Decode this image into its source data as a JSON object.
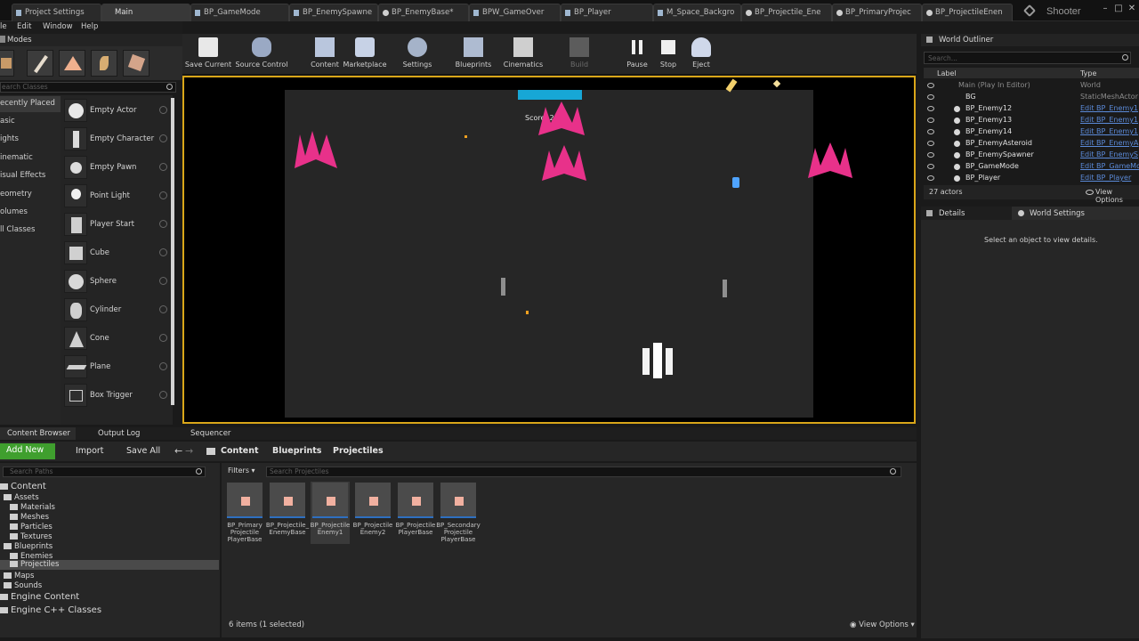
{
  "tabs": [
    {
      "label": "Project Settings",
      "icon": "gear-icon"
    },
    {
      "label": "Main",
      "icon": "level-icon"
    },
    {
      "label": "BP_GameMode",
      "icon": "blueprint-icon"
    },
    {
      "label": "BP_EnemySpawne",
      "icon": "blueprint-icon"
    },
    {
      "label": "BP_EnemyBase*",
      "icon": "blueprint-icon"
    },
    {
      "label": "BPW_GameOver",
      "icon": "widget-icon"
    },
    {
      "label": "BP_Player",
      "icon": "blueprint-icon"
    },
    {
      "label": "M_Space_Backgro",
      "icon": "material-icon"
    },
    {
      "label": "BP_Projectile_Ene",
      "icon": "blueprint-icon"
    },
    {
      "label": "BP_PrimaryProjec",
      "icon": "blueprint-icon"
    },
    {
      "label": "BP_ProjectileEnen",
      "icon": "blueprint-icon"
    }
  ],
  "project_name": "Shooter",
  "menu": [
    "le",
    "Edit",
    "Window",
    "Help"
  ],
  "modes": {
    "title": "Modes",
    "search_placeholder": "earch Classes",
    "categories": [
      "ecently Placed",
      "asic",
      "ights",
      "inematic",
      "isual Effects",
      "eometry",
      "olumes",
      "ll Classes"
    ],
    "items": [
      "Empty Actor",
      "Empty Character",
      "Empty Pawn",
      "Point Light",
      "Player Start",
      "Cube",
      "Sphere",
      "Cylinder",
      "Cone",
      "Plane",
      "Box Trigger"
    ]
  },
  "toolbar": [
    {
      "label": "Save Current",
      "icon": "save-icon"
    },
    {
      "label": "Source Control",
      "icon": "source-control-icon"
    },
    {
      "label": "Content",
      "icon": "content-icon"
    },
    {
      "label": "Marketplace",
      "icon": "marketplace-icon"
    },
    {
      "label": "Settings",
      "icon": "settings-icon"
    },
    {
      "label": "Blueprints",
      "icon": "blueprints-icon"
    },
    {
      "label": "Cinematics",
      "icon": "cinematics-icon"
    },
    {
      "label": "Build",
      "icon": "build-icon"
    },
    {
      "label": "Pause",
      "icon": "pause-icon"
    },
    {
      "label": "Stop",
      "icon": "stop-icon"
    },
    {
      "label": "Eject",
      "icon": "eject-icon"
    }
  ],
  "game": {
    "score_text": "Score: 25",
    "health_color": "#17a7d6",
    "enemy_color": "#e8318a"
  },
  "world_outliner": {
    "title": "World Outliner",
    "search_placeholder": "Search...",
    "col_label": "Label",
    "col_type": "Type",
    "rows": [
      {
        "label": "Main (Play In Editor)",
        "type": "World",
        "link": false
      },
      {
        "label": "BG",
        "type": "StaticMeshActor",
        "link": false
      },
      {
        "label": "BP_Enemy12",
        "type": "Edit BP_Enemy1",
        "link": true
      },
      {
        "label": "BP_Enemy13",
        "type": "Edit BP_Enemy1",
        "link": true
      },
      {
        "label": "BP_Enemy14",
        "type": "Edit BP_Enemy1",
        "link": true
      },
      {
        "label": "BP_EnemyAsteroid",
        "type": "Edit BP_EnemyA",
        "link": true
      },
      {
        "label": "BP_EnemySpawner",
        "type": "Edit BP_EnemyS",
        "link": true
      },
      {
        "label": "BP_GameMode",
        "type": "Edit BP_GameMo",
        "link": true
      },
      {
        "label": "BP_Player",
        "type": "Edit BP_Player",
        "link": true
      }
    ],
    "actor_count": "27 actors",
    "view_options": "View Options"
  },
  "details": {
    "tab_details": "Details",
    "tab_world_settings": "World Settings",
    "empty_text": "Select an object to view details."
  },
  "bottom_tabs": [
    "Content Browser",
    "Output Log",
    "Sequencer"
  ],
  "content_browser": {
    "add_new": "Add New",
    "import": "Import",
    "save_all": "Save All",
    "breadcrumbs": [
      "Content",
      "Blueprints",
      "Projectiles"
    ],
    "search_paths": "Search Paths",
    "filters": "Filters",
    "search_projectiles": "Search Projectiles",
    "tree": [
      {
        "label": "Content",
        "indent": 0,
        "big": true
      },
      {
        "label": "Assets",
        "indent": 1
      },
      {
        "label": "Materials",
        "indent": 2
      },
      {
        "label": "Meshes",
        "indent": 2
      },
      {
        "label": "Particles",
        "indent": 2
      },
      {
        "label": "Textures",
        "indent": 2
      },
      {
        "label": "Blueprints",
        "indent": 1
      },
      {
        "label": "Enemies",
        "indent": 2
      },
      {
        "label": "Projectiles",
        "indent": 2,
        "selected": true
      },
      {
        "label": "Maps",
        "indent": 1
      },
      {
        "label": "Sounds",
        "indent": 1
      },
      {
        "label": "Engine Content",
        "indent": 0,
        "big": true
      },
      {
        "label": "Engine C++ Classes",
        "indent": 0,
        "big": true
      }
    ],
    "assets": [
      {
        "label": "BP_Primary Projectile PlayerBase"
      },
      {
        "label": "BP_Projectile_ EnemyBase"
      },
      {
        "label": "BP_Projectile Enemy1",
        "selected": true
      },
      {
        "label": "BP_Projectile Enemy2"
      },
      {
        "label": "BP_Projectile PlayerBase"
      },
      {
        "label": "BP_Secondary Projectile PlayerBase"
      }
    ],
    "status": "6 items (1 selected)",
    "view_options": "View Options"
  }
}
